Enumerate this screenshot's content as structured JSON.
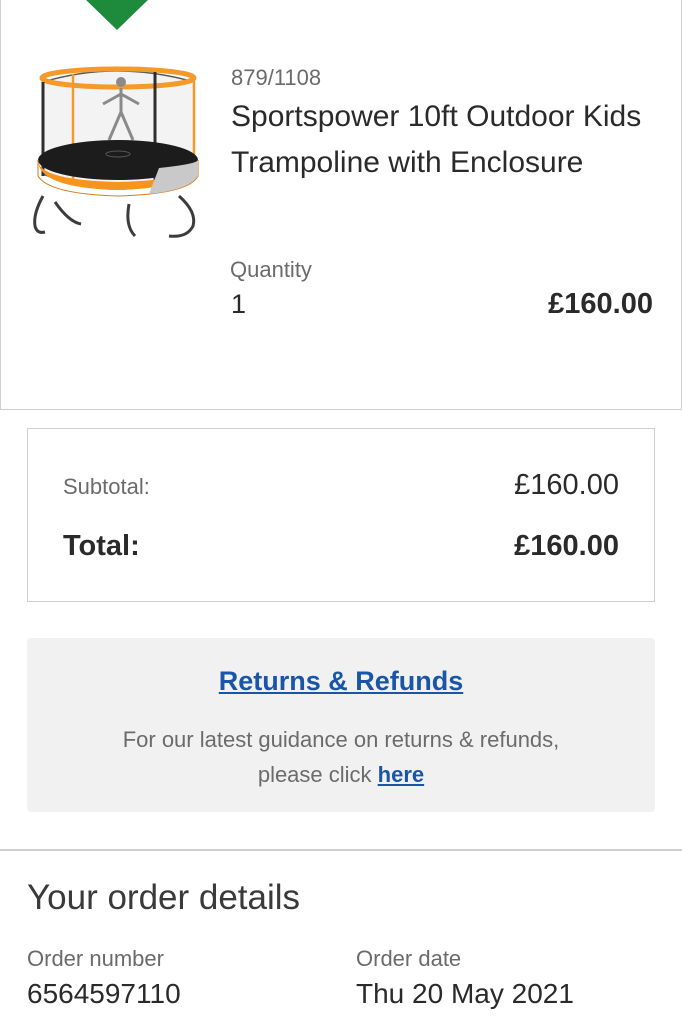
{
  "product": {
    "sku": "879/1108",
    "title": "Sportspower 10ft Outdoor Kids Trampoline with Enclosure",
    "quantity_label": "Quantity",
    "quantity_value": "1",
    "price": "£160.00",
    "image_icon": "trampoline-image",
    "check_color": "#1e8a3c"
  },
  "totals": {
    "subtotal_label": "Subtotal:",
    "subtotal_value": "£160.00",
    "total_label": "Total:",
    "total_value": "£160.00"
  },
  "returns": {
    "heading": "Returns & Refunds",
    "text": "For our latest guidance on returns & refunds,",
    "text2": "please click",
    "link": "here",
    "link_color": "#1a56a8"
  },
  "order_details": {
    "heading": "Your order details",
    "order_number_label": "Order number",
    "order_number_value": "6564597110",
    "order_date_label": "Order date",
    "order_date_value": "Thu 20 May 2021"
  }
}
